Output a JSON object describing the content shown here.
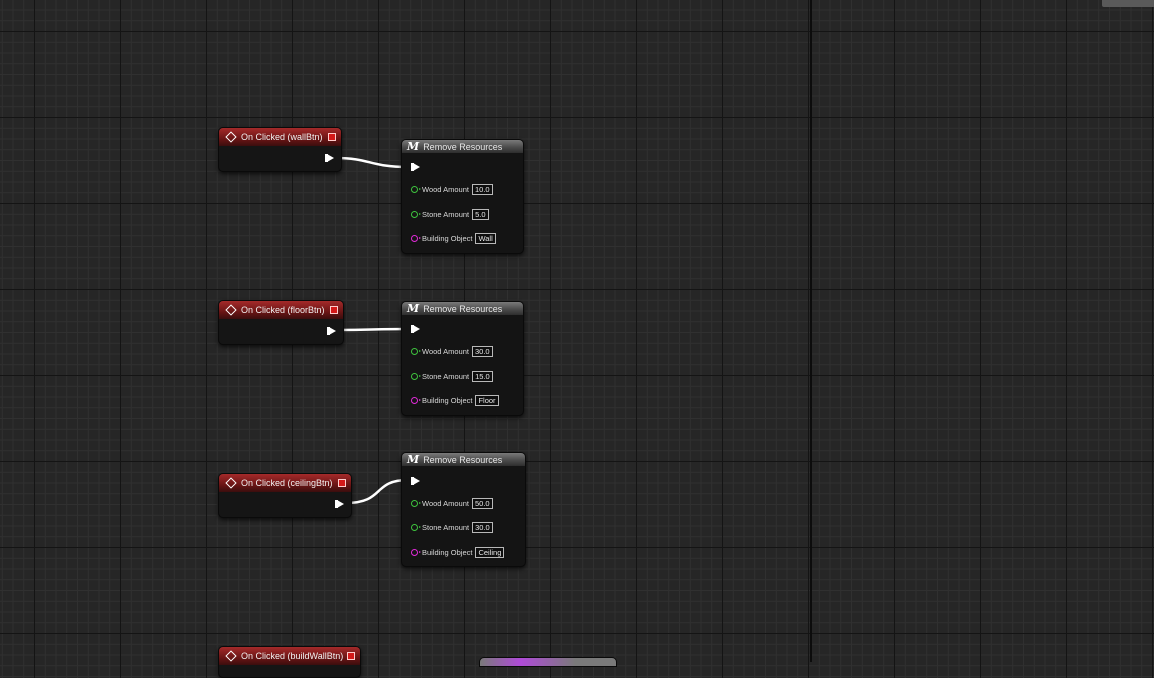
{
  "graph": {
    "events": [
      {
        "label": "On Clicked (wallBtn)"
      },
      {
        "label": "On Clicked (floorBtn)"
      },
      {
        "label": "On Clicked (ceilingBtn)"
      },
      {
        "label": "On Clicked (buildWallBtn)"
      }
    ],
    "functions": [
      {
        "title": "Remove Resources",
        "icon": "M",
        "pins": [
          {
            "label": "Wood Amount",
            "value": "10.0"
          },
          {
            "label": "Stone Amount",
            "value": "5.0"
          },
          {
            "label": "Building Object",
            "value": "Wall"
          }
        ]
      },
      {
        "title": "Remove Resources",
        "icon": "M",
        "pins": [
          {
            "label": "Wood Amount",
            "value": "30.0"
          },
          {
            "label": "Stone Amount",
            "value": "15.0"
          },
          {
            "label": "Building Object",
            "value": "Floor"
          }
        ]
      },
      {
        "title": "Remove Resources",
        "icon": "M",
        "pins": [
          {
            "label": "Wood Amount",
            "value": "50.0"
          },
          {
            "label": "Stone Amount",
            "value": "30.0"
          },
          {
            "label": "Building Object",
            "value": "Ceiling"
          }
        ]
      }
    ]
  },
  "colors": {
    "background": "#262626",
    "event_header": "#a52a2a",
    "float_pin": "#3ec33e",
    "object_pin": "#e02ad8",
    "exec_wire": "#ffffff"
  }
}
